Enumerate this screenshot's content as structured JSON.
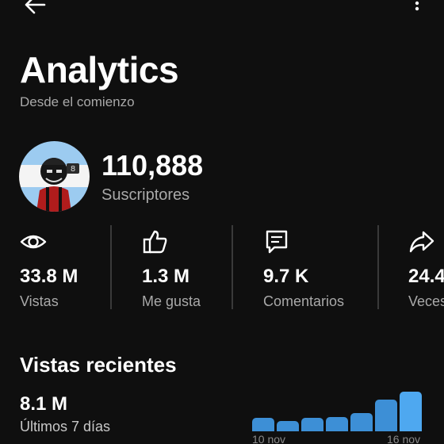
{
  "header": {
    "title": "Analytics",
    "subtitle": "Desde el comienzo"
  },
  "channel": {
    "subscribers": "110,888",
    "subscribers_label": "Suscriptores"
  },
  "stats": [
    {
      "icon": "eye-icon",
      "value": "33.8 M",
      "label": "Vistas"
    },
    {
      "icon": "thumbs-up-icon",
      "value": "1.3 M",
      "label": "Me gusta"
    },
    {
      "icon": "comment-icon",
      "value": "9.7 K",
      "label": "Comentarios"
    },
    {
      "icon": "share-icon",
      "value": "24.4",
      "label": "Veces"
    }
  ],
  "recent": {
    "title": "Vistas recientes",
    "value": "8.1 M",
    "period": "Últimos 7 días"
  },
  "chart_data": {
    "type": "bar",
    "x_labels": [
      "10 nov",
      "16 nov"
    ],
    "values": [
      0.34,
      0.25,
      0.34,
      0.36,
      0.45,
      0.8,
      1.0
    ],
    "highlight_index": 6
  },
  "colors": {
    "background": "#0f0f0f",
    "bar": "#3d8fd6",
    "bar_highlight": "#4ea8f0",
    "muted_text": "#a9a9a9"
  }
}
